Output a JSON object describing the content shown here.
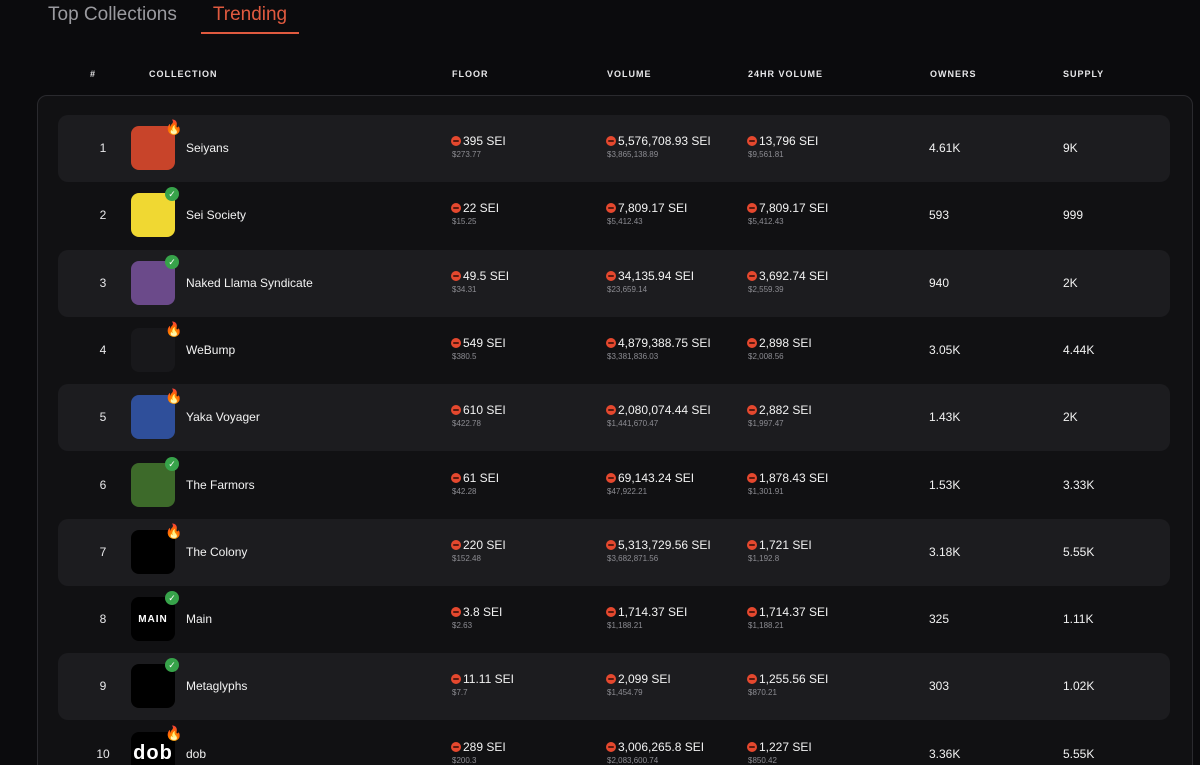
{
  "tabs": [
    {
      "label": "Top Collections",
      "active": false
    },
    {
      "label": "Trending",
      "active": true
    }
  ],
  "headers": {
    "rank": "#",
    "collection": "COLLECTION",
    "floor": "FLOOR",
    "volume": "VOLUME",
    "volume24h": "24HR VOLUME",
    "owners": "OWNERS",
    "supply": "SUPPLY"
  },
  "colors": {
    "accent": "#e05a3f",
    "sei": "#e5482e",
    "verified": "#37a34a"
  },
  "rows": [
    {
      "rank": "1",
      "name": "Seiyans",
      "badge": "fire-icon",
      "floor": "395 SEI",
      "floor_usd": "$273.77",
      "volume": "5,576,708.93 SEI",
      "volume_usd": "$3,865,138.89",
      "vol24": "13,796 SEI",
      "vol24_usd": "$9,561.81",
      "owners": "4.61K",
      "supply": "9K",
      "avatar_color": "#c8442a"
    },
    {
      "rank": "2",
      "name": "Sei Society",
      "badge": "verified-icon",
      "floor": "22 SEI",
      "floor_usd": "$15.25",
      "volume": "7,809.17 SEI",
      "volume_usd": "$5,412.43",
      "vol24": "7,809.17 SEI",
      "vol24_usd": "$5,412.43",
      "owners": "593",
      "supply": "999",
      "avatar_color": "#f0d832"
    },
    {
      "rank": "3",
      "name": "Naked Llama Syndicate",
      "badge": "verified-icon",
      "floor": "49.5 SEI",
      "floor_usd": "$34.31",
      "volume": "34,135.94 SEI",
      "volume_usd": "$23,659.14",
      "vol24": "3,692.74 SEI",
      "vol24_usd": "$2,559.39",
      "owners": "940",
      "supply": "2K",
      "avatar_color": "#6b4a8a"
    },
    {
      "rank": "4",
      "name": "WeBump",
      "badge": "fire-icon",
      "floor": "549 SEI",
      "floor_usd": "$380.5",
      "volume": "4,879,388.75 SEI",
      "volume_usd": "$3,381,836.03",
      "vol24": "2,898 SEI",
      "vol24_usd": "$2,008.56",
      "owners": "3.05K",
      "supply": "4.44K",
      "avatar_color": "#18181b"
    },
    {
      "rank": "5",
      "name": "Yaka Voyager",
      "badge": "fire-icon",
      "floor": "610 SEI",
      "floor_usd": "$422.78",
      "volume": "2,080,074.44 SEI",
      "volume_usd": "$1,441,670.47",
      "vol24": "2,882 SEI",
      "vol24_usd": "$1,997.47",
      "owners": "1.43K",
      "supply": "2K",
      "avatar_color": "#2f4f9a"
    },
    {
      "rank": "6",
      "name": "The Farmors",
      "badge": "verified-icon",
      "floor": "61 SEI",
      "floor_usd": "$42.28",
      "volume": "69,143.24 SEI",
      "volume_usd": "$47,922.21",
      "vol24": "1,878.43 SEI",
      "vol24_usd": "$1,301.91",
      "owners": "1.53K",
      "supply": "3.33K",
      "avatar_color": "#3d6a2a"
    },
    {
      "rank": "7",
      "name": "The Colony",
      "badge": "fire-icon",
      "floor": "220 SEI",
      "floor_usd": "$152.48",
      "volume": "5,313,729.56 SEI",
      "volume_usd": "$3,682,871.56",
      "vol24": "1,721 SEI",
      "vol24_usd": "$1,192.8",
      "owners": "3.18K",
      "supply": "5.55K",
      "avatar_color": "#000000"
    },
    {
      "rank": "8",
      "name": "Main",
      "badge": "verified-icon",
      "floor": "3.8 SEI",
      "floor_usd": "$2.63",
      "volume": "1,714.37 SEI",
      "volume_usd": "$1,188.21",
      "vol24": "1,714.37 SEI",
      "vol24_usd": "$1,188.21",
      "owners": "325",
      "supply": "1.11K",
      "avatar_color": "#000000",
      "avatar_text": "MAIN"
    },
    {
      "rank": "9",
      "name": "Metaglyphs",
      "badge": "verified-icon",
      "floor": "11.11 SEI",
      "floor_usd": "$7.7",
      "volume": "2,099 SEI",
      "volume_usd": "$1,454.79",
      "vol24": "1,255.56 SEI",
      "vol24_usd": "$870.21",
      "owners": "303",
      "supply": "1.02K",
      "avatar_color": "#000000"
    },
    {
      "rank": "10",
      "name": "dob",
      "badge": "fire-icon",
      "floor": "289 SEI",
      "floor_usd": "$200.3",
      "volume": "3,006,265.8 SEI",
      "volume_usd": "$2,083,600.74",
      "vol24": "1,227 SEI",
      "vol24_usd": "$850.42",
      "owners": "3.36K",
      "supply": "5.55K",
      "avatar_color": "#000000",
      "avatar_text": "dob"
    }
  ]
}
